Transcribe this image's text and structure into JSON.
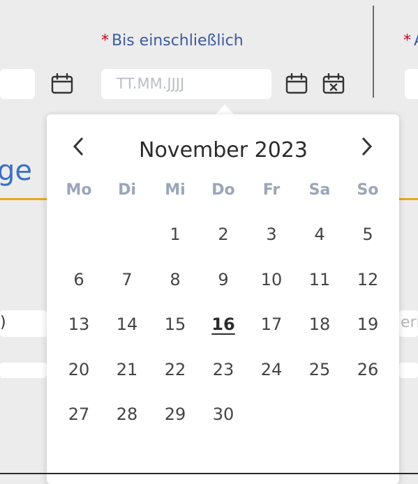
{
  "form": {
    "end_date_label": "Bis einschließlich",
    "end_date_placeholder": "TT.MM.JJJJ",
    "required_mark": "*",
    "next_label_fragment": "A"
  },
  "background": {
    "heading_fragment": "ge",
    "left_field_fragment": ")",
    "right_field_fragment": "erk"
  },
  "calendar": {
    "month_label": "November 2023",
    "weekdays": [
      "Mo",
      "Di",
      "Mi",
      "Do",
      "Fr",
      "Sa",
      "So"
    ],
    "weeks": [
      [
        "",
        "",
        "1",
        "2",
        "3",
        "4",
        "5"
      ],
      [
        "6",
        "7",
        "8",
        "9",
        "10",
        "11",
        "12"
      ],
      [
        "13",
        "14",
        "15",
        "16",
        "17",
        "18",
        "19"
      ],
      [
        "20",
        "21",
        "22",
        "23",
        "24",
        "25",
        "26"
      ],
      [
        "27",
        "28",
        "29",
        "30",
        "",
        "",
        ""
      ]
    ],
    "today": "16"
  },
  "icons": {
    "calendar": "calendar-icon",
    "calendar_clear": "calendar-clear-icon",
    "prev": "chevron-left-icon",
    "next": "chevron-right-icon"
  }
}
